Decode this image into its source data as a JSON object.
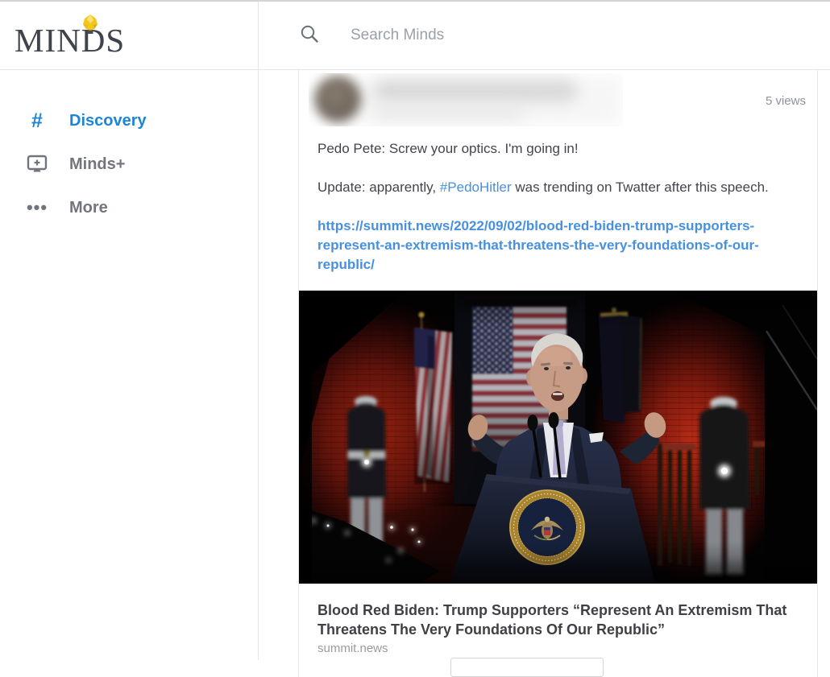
{
  "sidebar": {
    "logo": {
      "word_m": "M",
      "word_i": "I",
      "word_nds": "NDS",
      "bulb_icon": "lightbulb-icon"
    },
    "nav": [
      {
        "id": "discovery",
        "label": "Discovery",
        "icon": "hashtag-icon",
        "active": true
      },
      {
        "id": "minds-plus",
        "label": "Minds+",
        "icon": "minds-plus-monitor-icon",
        "active": false
      },
      {
        "id": "more",
        "label": "More",
        "icon": "ellipsis-icon",
        "active": false
      }
    ]
  },
  "header": {
    "search_placeholder": "Search Minds",
    "search_icon": "magnifier-icon"
  },
  "feed": {
    "post": {
      "views_label": "5 views",
      "paragraph_1": "Pedo Pete: Screw your optics. I'm going in!",
      "paragraph_2_before": "Update: apparently, ",
      "paragraph_2_hashtag": "#PedoHitler",
      "paragraph_2_after": " was trending on Twatter after this speech.",
      "link_url": "https://summit.news/2022/09/02/blood-red-biden-trump-supporters-represent-an-extremism-that-threatens-the-very-foundations-of-our-republic/",
      "embed": {
        "headline": "Blood Red Biden: Trump Supporters “Represent An Extremism That Threatens The Very Foundations Of Our Republic”",
        "source": "summit.news",
        "image_description": "biden-red-lit-speech-photo"
      }
    }
  },
  "colors": {
    "accent_blue": "#1b85d6",
    "link_blue": "#4690df",
    "text_dark": "#43434d",
    "text_gray": "#8d939e",
    "border": "#e6e9eb"
  }
}
